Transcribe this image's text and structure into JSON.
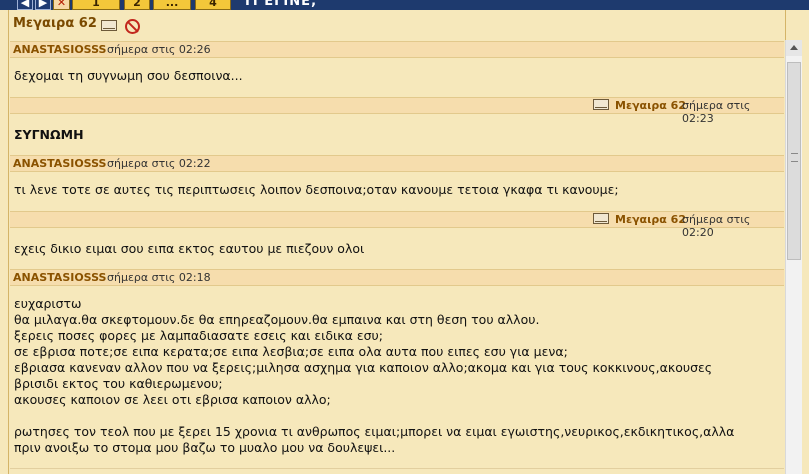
{
  "pagination": {
    "first_label": "◀",
    "next_label": "▶",
    "close_label": "✕",
    "pages": [
      "1",
      "2",
      "...",
      "4"
    ],
    "topic_title": "ΤΙ ΕΓΙΝΕ;"
  },
  "conversation": {
    "sender_name": "Μεγαιρα 62",
    "envelope_icon": "envelope-icon",
    "no_mail_icon": "no-mail-icon"
  },
  "posts": [
    {
      "author": "ANASTASIOSSS",
      "time": "σήμερα στις 02:26",
      "text": "δεχομαι τη συγνωμη σου δεσποινα..."
    },
    {
      "author": "Μεγαιρα 62",
      "time": "σήμερα στις 02:23",
      "text": "ΣΥΓΝΩΜΗ"
    },
    {
      "author": "ANASTASIOSSS",
      "time": "σήμερα στις 02:22",
      "text": "τι λενε τοτε σε αυτες τις περιπτωσεις λοιπον δεσποινα;οταν κανουμε τετοια γκαφα τι κανουμε;"
    },
    {
      "author": "Μεγαιρα 62",
      "time": "σήμερα στις 02:20",
      "text": "εχεις δικιο ειμαι σου ειπα εκτος εαυτου με πιεζουν ολοι"
    },
    {
      "author": "ANASTASIOSSS",
      "time": "σήμερα στις 02:18",
      "text": "ευχαριστω\nθα μιλαγα.θα σκεφτομουν.δε θα επηρεαζομουν.θα εμπαινα και στη θεση του αλλου.\nξερεις ποσες φορες με λαμπαδιασατε εσεις και ειδικα εσυ;\nσε εβρισα ποτε;σε ειπα κερατα;σε ειπα λεσβια;σε ειπα ολα αυτα που ειπες εσυ για μενα;\nεβριασα κανεναν αλλον που να ξερεις;μιλησα ασχημα για καποιον αλλο;ακομα και για τους κοκκινους,ακουσες\nβρισιδι εκτος του καθιερωμενου;\nακουσες καποιον σε λεει οτι εβρισα καποιον αλλο;\n\nρωτησες τον τεολ που με ξερει 15 χρονια τι ανθρωπος ειμαι;μπορει να ειμαι εγωιστης,νευρικος,εκδικητικος,αλλα\nπριν ανοιξω το στομα μου βαζω το μυαλο μου να δουλεψει..."
    }
  ],
  "colors": {
    "background": "#f6e8bb",
    "header_bar": "#f6ddad",
    "author_name": "#8a5200",
    "top_bar": "#1e3a6e"
  }
}
